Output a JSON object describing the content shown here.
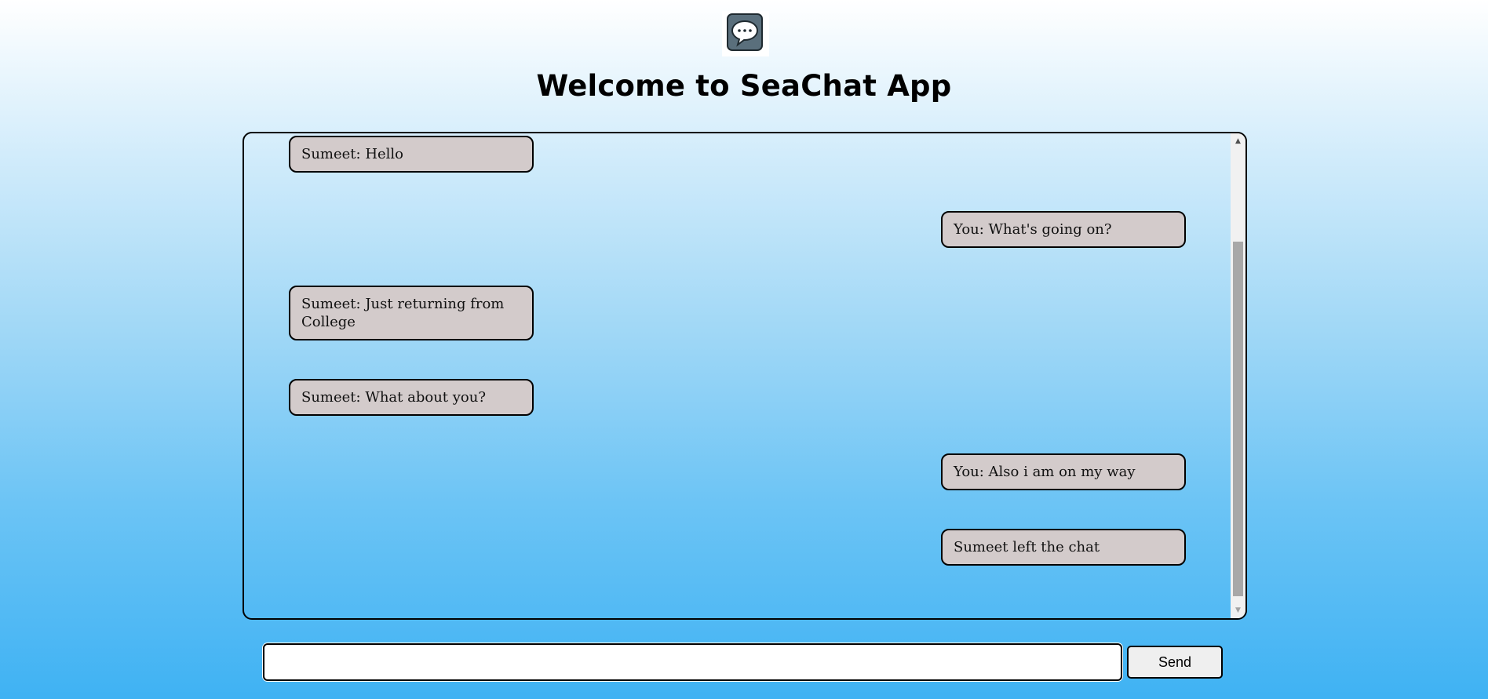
{
  "app": {
    "title": "Welcome to SeaChat App",
    "logo_icon": "chat-bubble-icon"
  },
  "chat": {
    "messages": [
      {
        "text": "Sumeet: Hello",
        "side": "left"
      },
      {
        "text": "You: What's going on?",
        "side": "right"
      },
      {
        "text": "Sumeet: Just returning from College",
        "side": "left"
      },
      {
        "text": "Sumeet: What about you?",
        "side": "left"
      },
      {
        "text": "You: Also i am on my way",
        "side": "right"
      },
      {
        "text": "Sumeet left the chat",
        "side": "right"
      }
    ]
  },
  "composer": {
    "input_value": "",
    "send_label": "Send"
  },
  "colors": {
    "message_bubble": "#d3cbcb",
    "gradient_top": "#ffffff",
    "gradient_bottom": "#3fb2f3"
  }
}
